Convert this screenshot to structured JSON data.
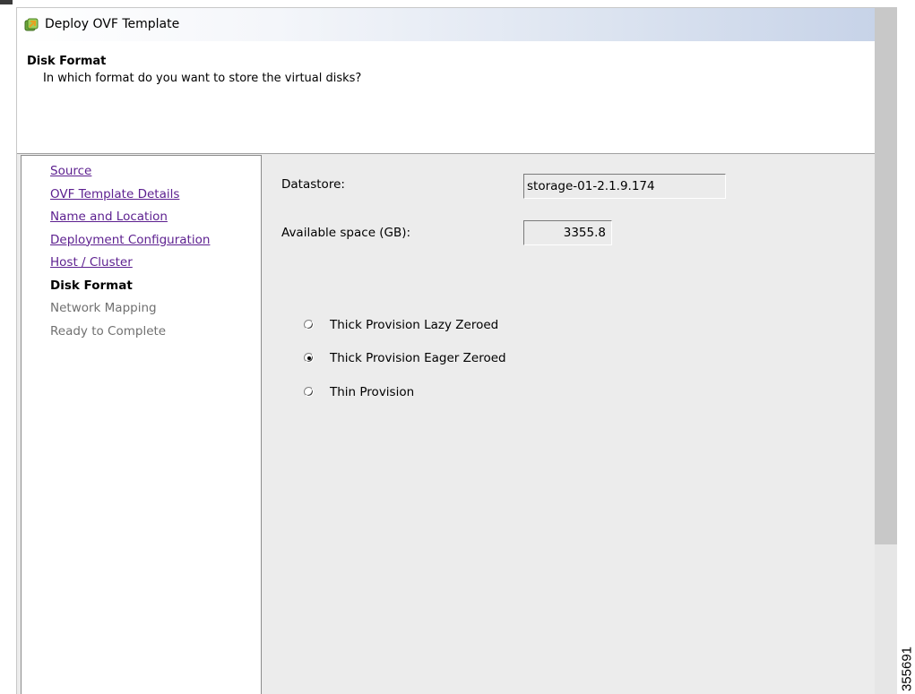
{
  "window": {
    "title": "Deploy OVF Template",
    "icon": "ovf-template-icon"
  },
  "header": {
    "title": "Disk Format",
    "subtitle": "In which format do you want to store the virtual disks?"
  },
  "steps": [
    {
      "label": "Source",
      "state": "completed"
    },
    {
      "label": "OVF Template Details",
      "state": "completed"
    },
    {
      "label": "Name and Location",
      "state": "completed"
    },
    {
      "label": "Deployment Configuration",
      "state": "completed"
    },
    {
      "label": "Host / Cluster",
      "state": "completed"
    },
    {
      "label": "Disk Format",
      "state": "current"
    },
    {
      "label": "Network Mapping",
      "state": "pending"
    },
    {
      "label": "Ready to Complete",
      "state": "pending"
    }
  ],
  "form": {
    "datastore_label": "Datastore:",
    "datastore_value": "storage-01-2.1.9.174",
    "available_space_label": "Available space (GB):",
    "available_space_value": "3355.8"
  },
  "disk_format_options": [
    {
      "label": "Thick Provision Lazy Zeroed",
      "selected": false
    },
    {
      "label": "Thick Provision Eager Zeroed",
      "selected": true
    },
    {
      "label": "Thin Provision",
      "selected": false
    }
  ],
  "figure_id": "355691",
  "colors": {
    "visited_link": "#5c1f8f",
    "pending_step": "#707070",
    "panel_background": "#ececec",
    "titlebar_gradient_end": "#c7d3e8"
  }
}
